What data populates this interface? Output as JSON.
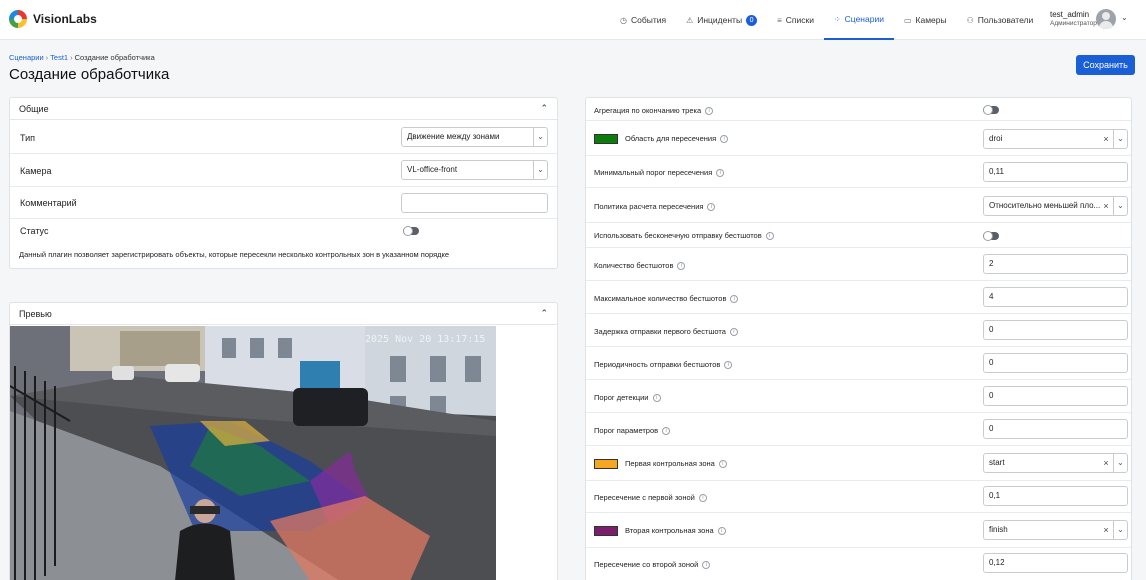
{
  "brand": {
    "name": "VisionLabs"
  },
  "nav": [
    {
      "id": "events",
      "icon": "clock-icon",
      "glyph": "◷",
      "label": "События",
      "active": false
    },
    {
      "id": "incidents",
      "icon": "warning-icon",
      "glyph": "⚠",
      "label": "Инциденты",
      "badge": "0",
      "active": false
    },
    {
      "id": "lists",
      "icon": "list-icon",
      "glyph": "≡",
      "label": "Списки",
      "active": false
    },
    {
      "id": "scenarios",
      "icon": "grid-icon",
      "glyph": "⁘",
      "label": "Сценарии",
      "active": true
    },
    {
      "id": "cameras",
      "icon": "camera-icon",
      "glyph": "▭",
      "label": "Камеры",
      "active": false
    },
    {
      "id": "users",
      "icon": "users-icon",
      "glyph": "⚇",
      "label": "Пользователи",
      "active": false
    }
  ],
  "user": {
    "name": "test_admin",
    "role": "Администратор"
  },
  "breadcrumb": {
    "items": [
      "Сценарии",
      "Test1"
    ],
    "current": "Создание обработчика"
  },
  "page": {
    "title": "Создание обработчика",
    "save_label": "Сохранить"
  },
  "general": {
    "title": "Общие",
    "type_label": "Тип",
    "type_value": "Движение между зонами",
    "camera_label": "Камера",
    "camera_value": "VL-office-front",
    "comment_label": "Комментарий",
    "comment_value": "",
    "status_label": "Статус",
    "description": "Данный плагин позволяет зарегистрировать объекты, которые пересекли несколько контрольных зон в указанном порядке"
  },
  "preview": {
    "title": "Превью",
    "timestamp": "2025 Nov 20 13:17:15"
  },
  "settings": {
    "aggregation_label": "Агрегация по окончанию трека",
    "area_label": "Область для пересечения",
    "area_value": "droi",
    "area_color": "#0b7d0b",
    "min_threshold_label": "Минимальный порог пересечения",
    "min_threshold_value": "0,11",
    "policy_label": "Политика расчета пересечения",
    "policy_value": "Относительно меньшей пло...",
    "infinite_label": "Использовать бесконечную отправку бестшотов",
    "count_label": "Количество бестшотов",
    "count_value": "2",
    "max_count_label": "Максимальное количество бестшотов",
    "max_count_value": "4",
    "delay_label": "Задержка отправки первого бестшота",
    "delay_value": "0",
    "period_label": "Периодичность отправки бестшотов",
    "period_value": "0",
    "detection_label": "Порог детекции",
    "detection_value": "0",
    "params_label": "Порог параметров",
    "params_value": "0",
    "zone1_label": "Первая контрольная зона",
    "zone1_value": "start",
    "zone1_color": "#f5a623",
    "zone1_cross_label": "Пересечение с первой зоной",
    "zone1_cross_value": "0,1",
    "zone2_label": "Вторая контрольная зона",
    "zone2_value": "finish",
    "zone2_color": "#7b1e6e",
    "zone2_cross_label": "Пересечение со второй зоной",
    "zone2_cross_value": "0,12"
  }
}
